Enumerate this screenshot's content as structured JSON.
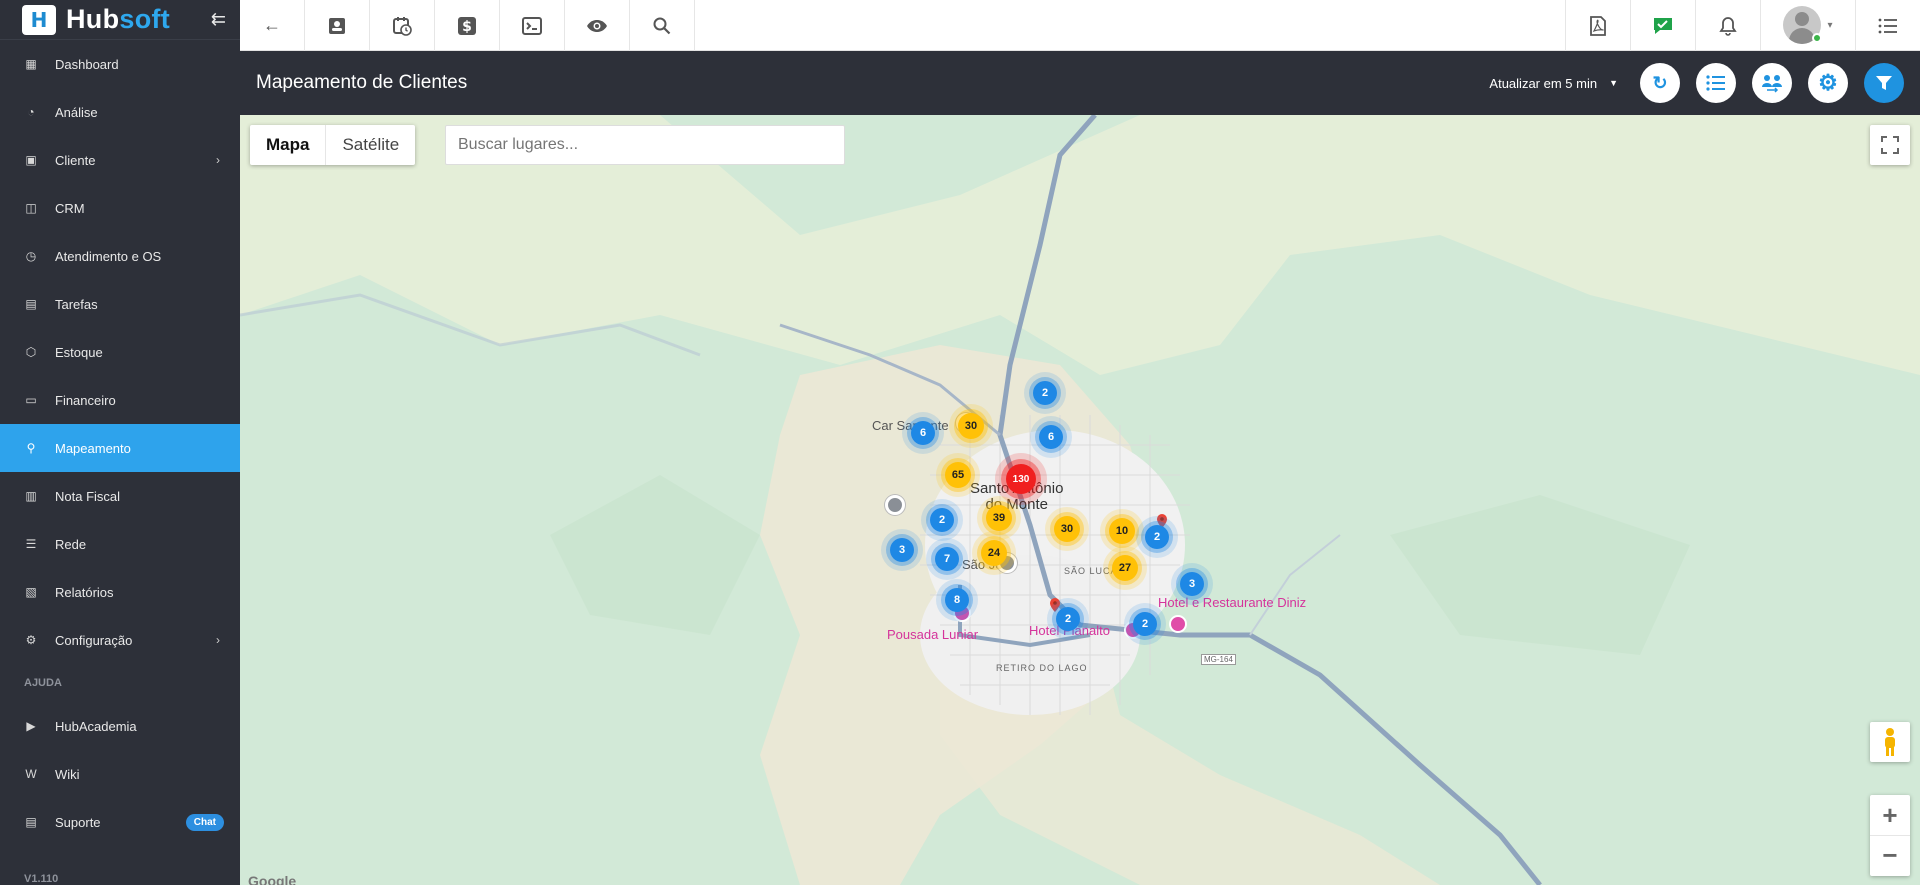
{
  "brand": {
    "name_part1": "Hub",
    "name_part2": "soft",
    "logo_letter": "H"
  },
  "sidebar": {
    "items": [
      {
        "label": "Dashboard",
        "icon": "dashboard-icon"
      },
      {
        "label": "Análise",
        "icon": "pie-chart-icon"
      },
      {
        "label": "Cliente",
        "icon": "contact-card-icon",
        "has_submenu": true
      },
      {
        "label": "CRM",
        "icon": "crm-board-icon"
      },
      {
        "label": "Atendimento e OS",
        "icon": "clock-calendar-icon"
      },
      {
        "label": "Tarefas",
        "icon": "tasks-icon"
      },
      {
        "label": "Estoque",
        "icon": "box-icon"
      },
      {
        "label": "Financeiro",
        "icon": "money-icon"
      },
      {
        "label": "Mapeamento",
        "icon": "map-pin-icon",
        "active": true
      },
      {
        "label": "Nota Fiscal",
        "icon": "invoice-icon"
      },
      {
        "label": "Rede",
        "icon": "network-icon"
      },
      {
        "label": "Relatórios",
        "icon": "report-icon"
      },
      {
        "label": "Configuração",
        "icon": "gear-icon",
        "has_submenu": true
      }
    ],
    "help_section": "AJUDA",
    "help_items": [
      {
        "label": "HubAcademia",
        "icon": "youtube-icon"
      },
      {
        "label": "Wiki",
        "icon": "wiki-icon"
      },
      {
        "label": "Suporte",
        "icon": "chat-bubble-icon",
        "badge": "Chat"
      }
    ],
    "version": "V1.110"
  },
  "topbar": {
    "buttons": [
      "back-arrow-icon",
      "contact-card-icon",
      "calendar-clock-icon",
      "dollar-icon",
      "terminal-icon",
      "eye-icon",
      "search-icon"
    ],
    "right_buttons": [
      "pdf-icon",
      "message-check-icon",
      "bell-icon"
    ]
  },
  "header": {
    "title": "Mapeamento de Clientes",
    "refresh_label": "Atualizar em 5 min"
  },
  "map": {
    "tabs": [
      "Mapa",
      "Satélite"
    ],
    "search_placeholder": "Buscar lugares...",
    "town_label_line1": "Santo Antônio",
    "town_label_line2": "do Monte",
    "labels": {
      "car_samonte": "Car Samonte",
      "sao_jose": "São José",
      "sao_lucas": "SÃO LUCAS",
      "hotel_diniz": "Hotel e Restaurante Diniz",
      "hotel_planalto": "Hotel Planalto",
      "pousada_luniar": "Pousada Luniar",
      "retiro": "RETIRO DO LAGO",
      "road": "MG-164"
    },
    "clusters": [
      {
        "count": "2",
        "color": "blue"
      },
      {
        "count": "6",
        "color": "blue"
      },
      {
        "count": "30",
        "color": "yellow"
      },
      {
        "count": "6",
        "color": "blue"
      },
      {
        "count": "65",
        "color": "yellow"
      },
      {
        "count": "130",
        "color": "red"
      },
      {
        "count": "39",
        "color": "yellow"
      },
      {
        "count": "2",
        "color": "blue"
      },
      {
        "count": "30",
        "color": "yellow"
      },
      {
        "count": "10",
        "color": "yellow"
      },
      {
        "count": "2",
        "color": "blue"
      },
      {
        "count": "3",
        "color": "blue"
      },
      {
        "count": "7",
        "color": "blue"
      },
      {
        "count": "24",
        "color": "yellow"
      },
      {
        "count": "27",
        "color": "yellow"
      },
      {
        "count": "3",
        "color": "blue"
      },
      {
        "count": "8",
        "color": "blue"
      },
      {
        "count": "2",
        "color": "blue"
      },
      {
        "count": "2",
        "color": "blue"
      }
    ],
    "google_text": "Google"
  }
}
